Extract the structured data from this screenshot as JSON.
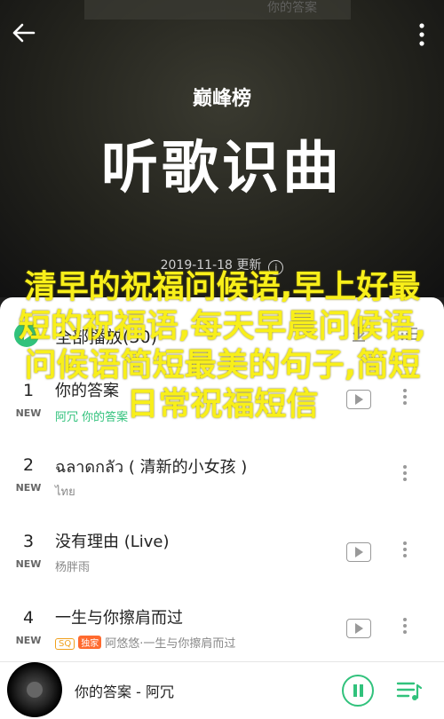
{
  "hero": {
    "top_art_text": "你的答案",
    "brand_logo_text": "巅峰榜",
    "title": "听歌识曲",
    "date": "2019-11-18 更新",
    "info_icon": "i"
  },
  "icons": {
    "back": "back-arrow-icon",
    "more": "more-vertical-icon",
    "play_all": "play-circle-icon",
    "download": "download-icon",
    "multi_select": "multi-select-icon",
    "mv": "mv-icon",
    "pause": "pause-icon",
    "queue": "playlist-icon"
  },
  "list": {
    "header_title": "全部播放(30)",
    "new_label": "NEW",
    "songs": [
      {
        "rank": "1",
        "title": "你的答案",
        "artist": "阿冗 你的答案"
      },
      {
        "rank": "2",
        "title": "ฉลาดกลัว ( 清新的小女孩 )",
        "artist": "ไทย"
      },
      {
        "rank": "3",
        "title": "没有理由 (Live)",
        "artist": "杨胖雨"
      },
      {
        "rank": "4",
        "title": "一生与你擦肩而过",
        "artist": "阿悠悠·一生与你擦肩而过",
        "badge_sq": "SQ",
        "badge_exclusive": "独家"
      }
    ]
  },
  "overlay_text": "清早的祝福问候语,早上好最短的祝福语,每天早晨问候语,问候语简短最美的句子,简短日常祝福短信",
  "player": {
    "now_playing": "你的答案 - 阿冗"
  },
  "colors": {
    "accent": "#31c27c",
    "overlay": "#f8ef1a"
  }
}
